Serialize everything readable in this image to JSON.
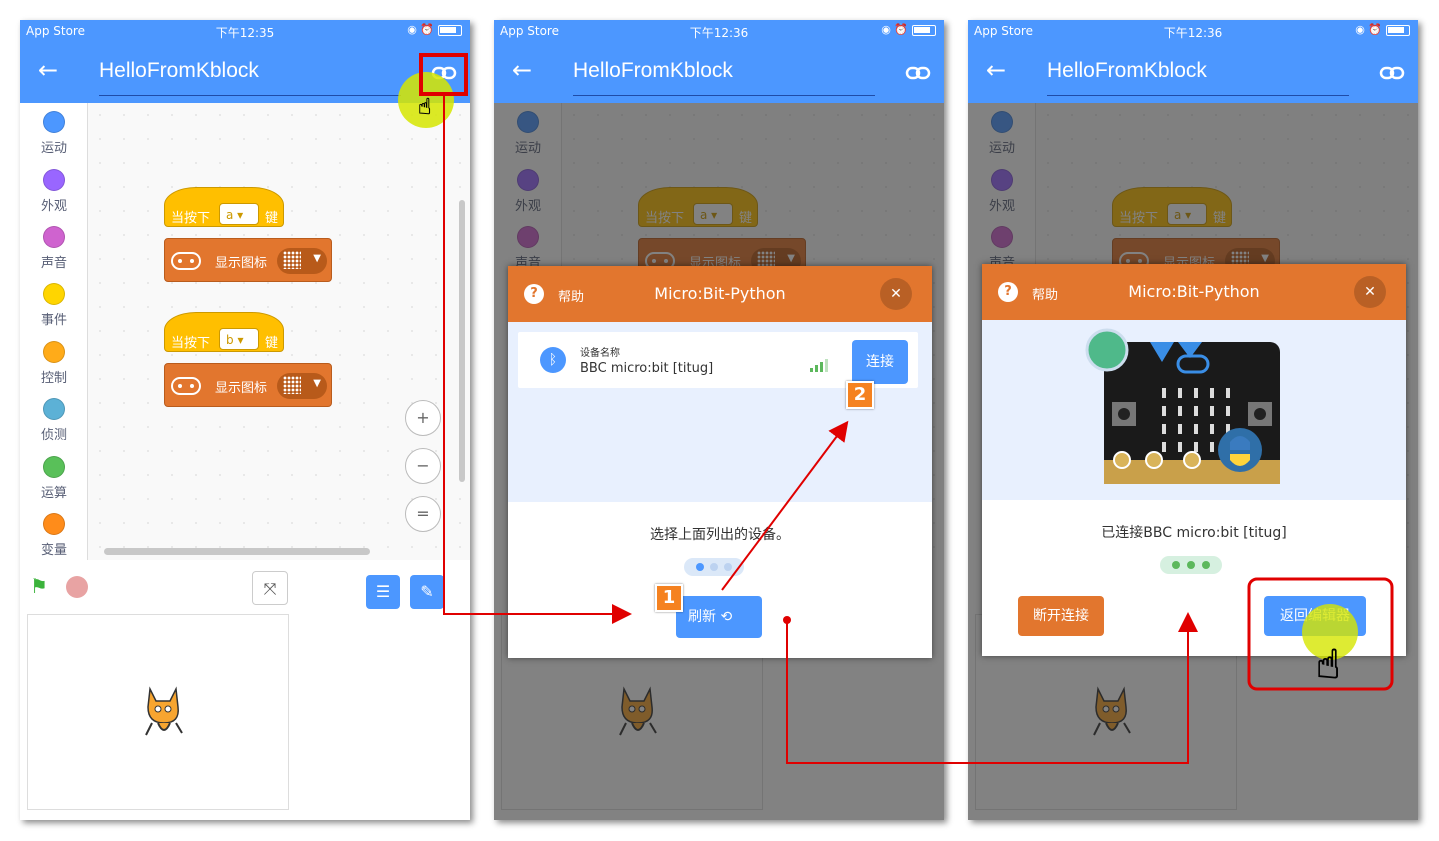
{
  "status": {
    "carrier": "App Store",
    "time_1": "下午12:35",
    "time_2": "下午12:36",
    "time_3": "下午12:36"
  },
  "app": {
    "title": "HelloFromKblock"
  },
  "categories": [
    {
      "label": "运动",
      "color": "#4c97ff"
    },
    {
      "label": "外观",
      "color": "#9966ff"
    },
    {
      "label": "声音",
      "color": "#cf63cf"
    },
    {
      "label": "事件",
      "color": "#ffd500"
    },
    {
      "label": "控制",
      "color": "#ffab19"
    },
    {
      "label": "侦测",
      "color": "#5cb1d6"
    },
    {
      "label": "运算",
      "color": "#59c059"
    },
    {
      "label": "变量",
      "color": "#ff8c1a"
    }
  ],
  "blocks": [
    {
      "when": "当按下",
      "key": "a",
      "suffix": "键",
      "action": "显示图标"
    },
    {
      "when": "当按下",
      "key": "b",
      "suffix": "键",
      "action": "显示图标"
    }
  ],
  "zoom": {
    "in": "+",
    "out": "−",
    "reset": "="
  },
  "dialog": {
    "help": "帮助",
    "title": "Micro:Bit-Python",
    "device_label": "设备名称",
    "device_name": "BBC micro:bit [titug]",
    "connect": "连接",
    "instruction": "选择上面列出的设备。",
    "refresh": "刷新",
    "connected": "已连接BBC micro:bit [titug]",
    "disconnect": "断开连接",
    "back_to_editor": "返回编辑器"
  },
  "badges": {
    "one": "1",
    "two": "2"
  },
  "colors": {
    "primary": "#4c97ff",
    "orange": "#e2762e",
    "annotation": "#e00000"
  }
}
